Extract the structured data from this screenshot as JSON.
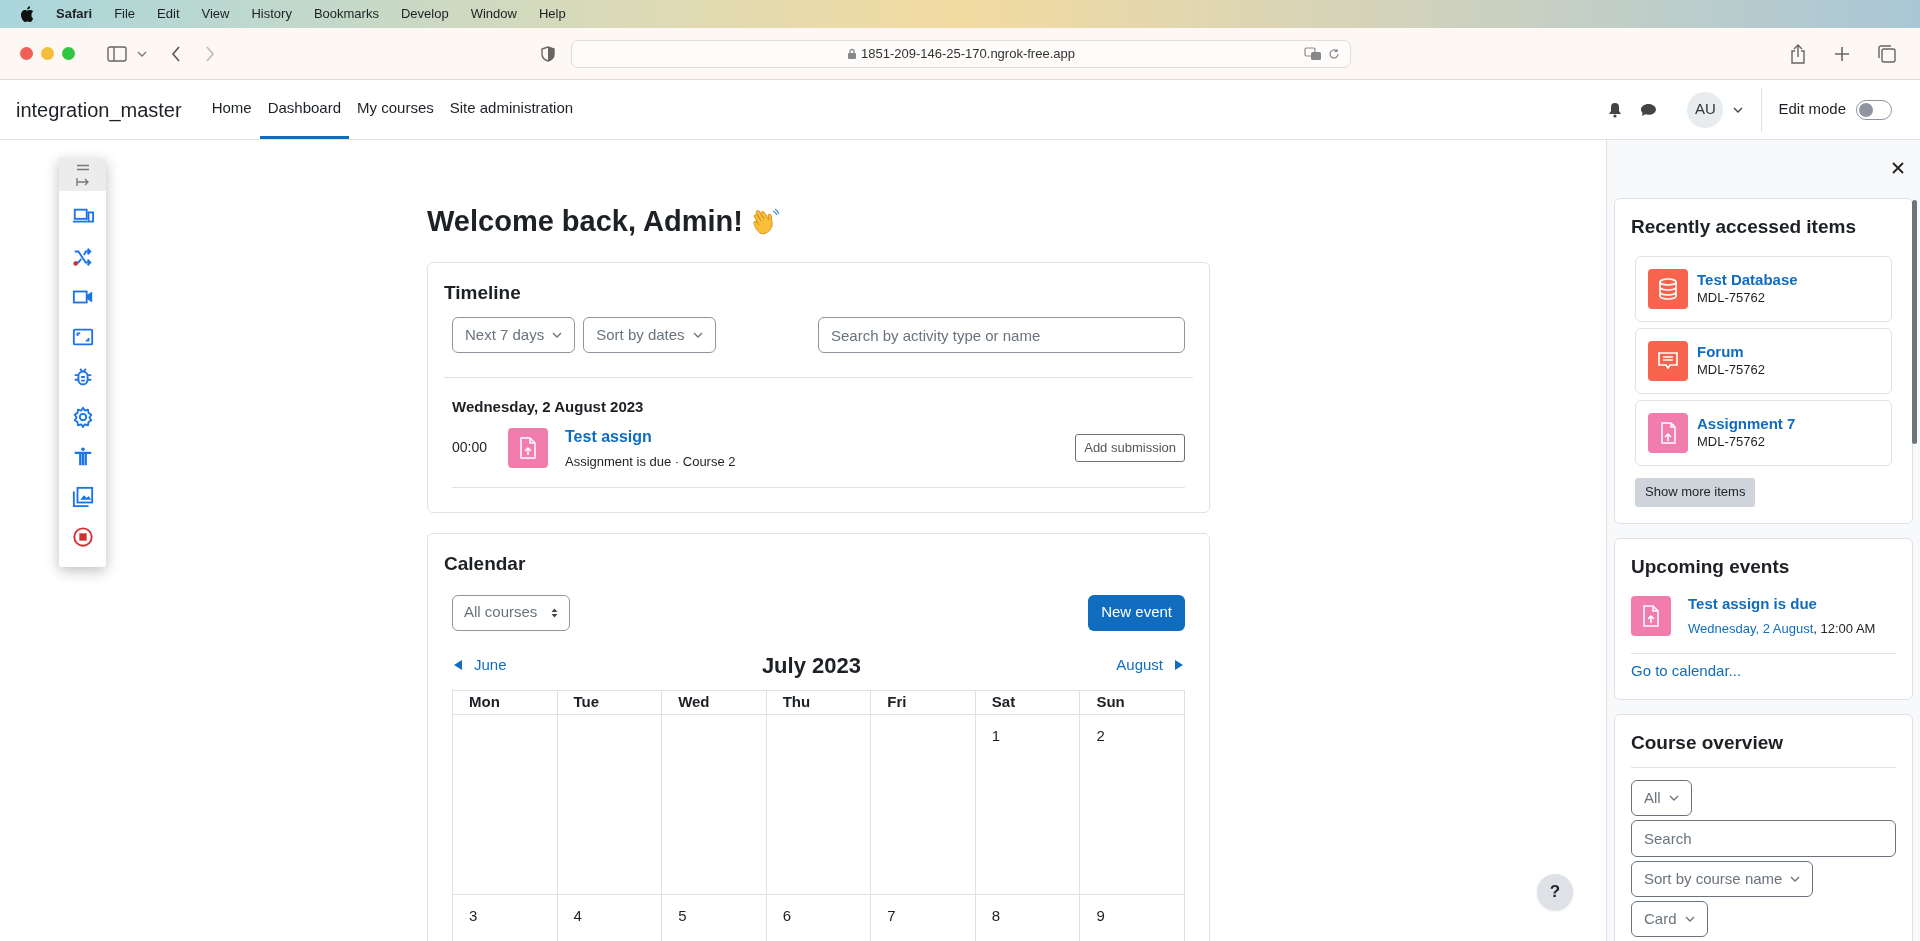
{
  "menubar": {
    "app": "Safari",
    "items": [
      "File",
      "Edit",
      "View",
      "History",
      "Bookmarks",
      "Develop",
      "Window",
      "Help"
    ]
  },
  "browser": {
    "url": "1851-209-146-25-170.ngrok-free.app"
  },
  "navbar": {
    "site": "integration_master",
    "links": [
      {
        "label": "Home",
        "selected": false
      },
      {
        "label": "Dashboard",
        "selected": true
      },
      {
        "label": "My courses",
        "selected": false
      },
      {
        "label": "Site administration",
        "selected": false
      }
    ],
    "avatar": "AU",
    "edit_mode": {
      "label": "Edit mode",
      "on": false
    }
  },
  "heading": "Welcome back, Admin!",
  "timeline": {
    "title": "Timeline",
    "filters": [
      "Next 7 days",
      "Sort by dates"
    ],
    "search": {
      "placeholder": "Search by activity type or name"
    },
    "groups": [
      {
        "date": "Wednesday, 2 August 2023",
        "events": [
          {
            "time": "00:00",
            "name": "Test assign",
            "detail": "Assignment is due · Course 2",
            "action": "Add submission"
          }
        ]
      }
    ]
  },
  "calendar": {
    "title": "Calendar",
    "course_filter": "All courses",
    "new_event": "New event",
    "prev": "June",
    "month": "July 2023",
    "next": "August",
    "weekdays": [
      "Mon",
      "Tue",
      "Wed",
      "Thu",
      "Fri",
      "Sat",
      "Sun"
    ],
    "weeks": [
      [
        {
          "kind": "blank"
        },
        {
          "kind": "blank"
        },
        {
          "kind": "blank"
        },
        {
          "kind": "blank"
        },
        {
          "kind": "blank"
        },
        {
          "kind": "day",
          "day": "1"
        },
        {
          "kind": "day",
          "day": "2"
        }
      ],
      [
        {
          "kind": "day",
          "day": "3"
        },
        {
          "kind": "day",
          "day": "4"
        },
        {
          "kind": "day",
          "day": "5"
        },
        {
          "kind": "day",
          "day": "6"
        },
        {
          "kind": "day",
          "day": "7"
        },
        {
          "kind": "day",
          "day": "8"
        },
        {
          "kind": "day",
          "day": "9"
        }
      ]
    ]
  },
  "drawer": {
    "recent": {
      "title": "Recently accessed items",
      "items": [
        {
          "kind": "database",
          "name": "Test Database",
          "course": "MDL-75762"
        },
        {
          "kind": "forum",
          "name": "Forum",
          "course": "MDL-75762"
        },
        {
          "kind": "assignment",
          "name": "Assignment 7",
          "course": "MDL-75762"
        }
      ],
      "more": "Show more items"
    },
    "upcoming": {
      "title": "Upcoming events",
      "events": [
        {
          "name": "Test assign is due",
          "date": "Wednesday, 2 August",
          "time": ", 12:00 AM"
        }
      ],
      "link": "Go to calendar..."
    },
    "overview": {
      "title": "Course overview",
      "filter": "All",
      "search": {
        "placeholder": "Search"
      },
      "sort": "Sort by course name",
      "view": "Card"
    }
  },
  "help": "?"
}
